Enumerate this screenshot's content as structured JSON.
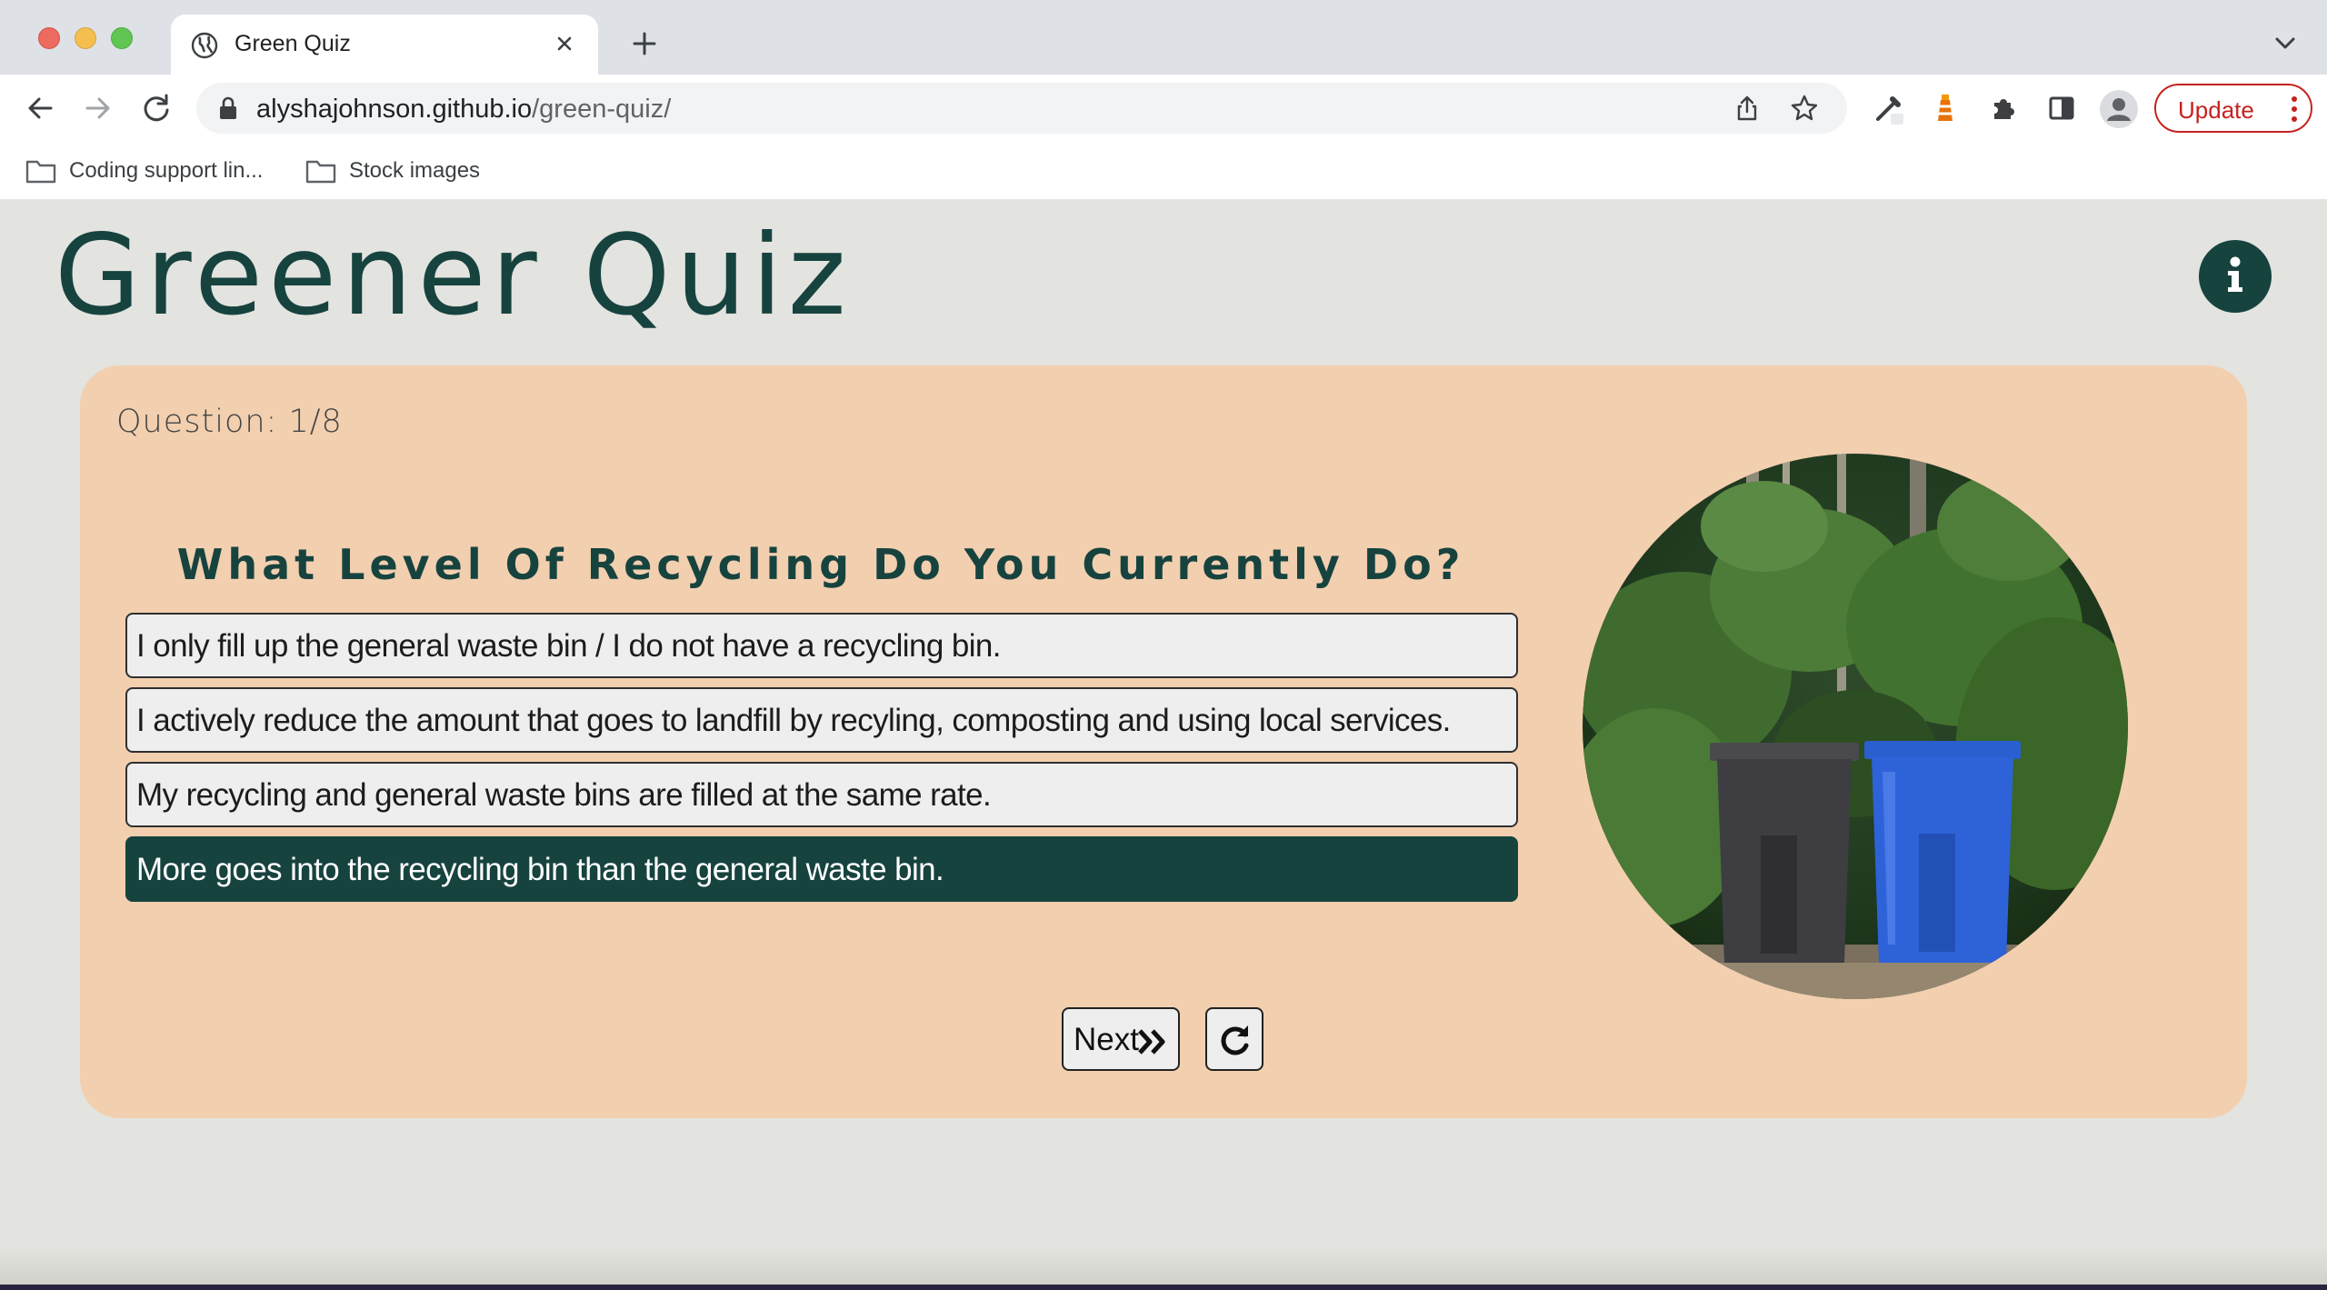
{
  "browser": {
    "tab_title": "Green Quiz",
    "url_host": "alyshajohnson.github.io",
    "url_path": "/green-quiz/",
    "update_label": "Update",
    "bookmarks": [
      {
        "label": "Coding support lin...",
        "icon": "folder-icon"
      },
      {
        "label": "Stock images",
        "icon": "folder-icon"
      }
    ]
  },
  "page": {
    "title": "Greener Quiz",
    "info_icon": "info-icon",
    "colors": {
      "primary": "#17433f",
      "card": "#f2cfaf",
      "background": "#e3e3df",
      "answer_bg": "#eeeeee"
    }
  },
  "quiz": {
    "counter": "Question: 1/8",
    "question": "What Level Of Recycling Do You Currently Do?",
    "answers": [
      {
        "label": "I only fill up the general waste bin / I do not have a recycling bin.",
        "selected": false
      },
      {
        "label": "I actively reduce the amount that goes to landfill by recyling, composting and using local services.",
        "selected": false
      },
      {
        "label": "My recycling and general waste bins are filled at the same rate.",
        "selected": false
      },
      {
        "label": "More goes into the recycling bin than the general waste bin.",
        "selected": true
      }
    ],
    "next_label": "Next",
    "next_icon": "double-chevron-right-icon",
    "reset_icon": "redo-icon",
    "image": "recycling-bins-photo"
  }
}
